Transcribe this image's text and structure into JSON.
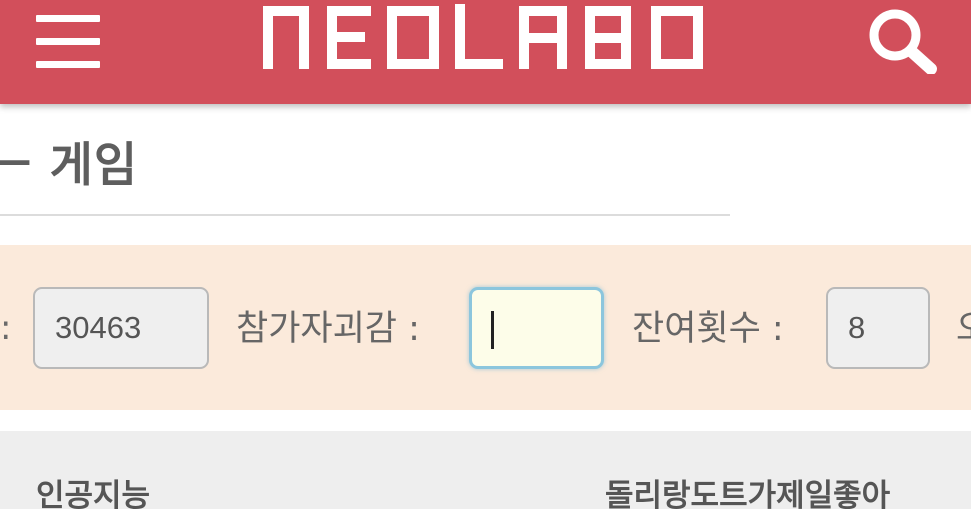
{
  "app_bar": {
    "logo_text": "NEOLABO",
    "background_color": "#d24f5b",
    "menu_icon": "hamburger-menu-icon",
    "search_icon": "search-icon"
  },
  "page": {
    "title_visible": "ㅡ 게임"
  },
  "form": {
    "lead_colon": ":",
    "field1_value": "30463",
    "field2_label": "참가자괴감 :",
    "field2_value": "",
    "field3_label": "잔여횟수 :",
    "field3_value": "8",
    "cutoff_text": "오"
  },
  "list": {
    "left_text": "인공지능",
    "right_text": "돌리랑도트가제일좋아"
  }
}
